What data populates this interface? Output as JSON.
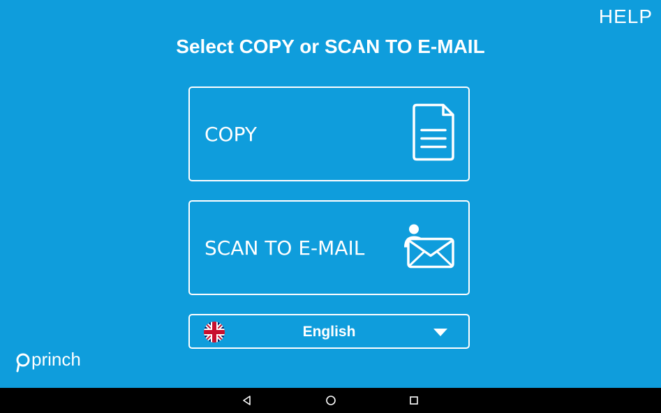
{
  "header": {
    "help_label": "HELP",
    "title": "Select COPY or SCAN TO E-MAIL"
  },
  "options": {
    "copy": {
      "label": "COPY",
      "icon": "document-icon"
    },
    "scan": {
      "label": "SCAN TO E-MAIL",
      "icon": "user-envelope-icon"
    }
  },
  "language": {
    "selected": "English",
    "flag_icon": "uk-flag-icon",
    "dropdown_icon": "triangle-down-icon"
  },
  "branding": {
    "logo": "princh",
    "logo_icon": "princh-logo"
  },
  "colors": {
    "background": "#0f9ddc",
    "foreground": "#ffffff",
    "nav_bar": "#000000"
  },
  "nav_bar": {
    "back_icon": "back-triangle-icon",
    "home_icon": "home-circle-icon",
    "recent_icon": "recent-apps-square-icon"
  }
}
